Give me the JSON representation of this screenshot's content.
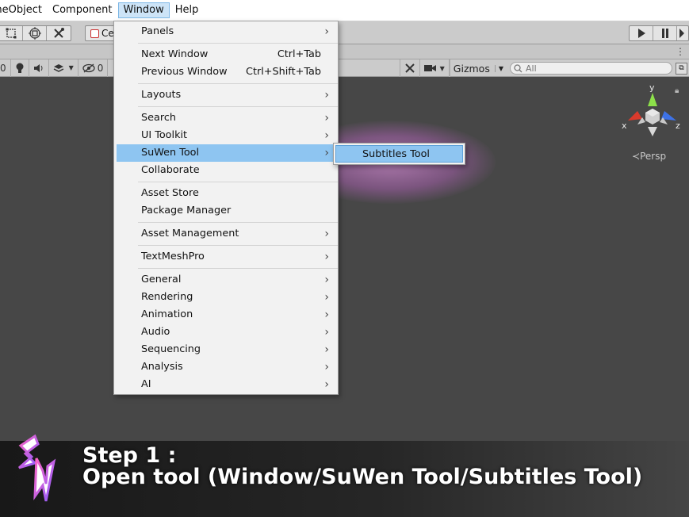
{
  "menubar": {
    "items": [
      "meObject",
      "Component",
      "Window",
      "Help"
    ]
  },
  "toolbar": {
    "pivot_label": "Ce"
  },
  "scene_bar": {
    "left_counter": "0",
    "hidden_count": "0",
    "gizmos_label": "Gizmos",
    "search_placeholder": "All"
  },
  "scene": {
    "persp_label": "Persp",
    "axis_labels": {
      "y": "y",
      "x": "x",
      "z": "z"
    }
  },
  "window_menu": {
    "groups": [
      [
        {
          "label": "Panels",
          "submenu": true
        }
      ],
      [
        {
          "label": "Next Window",
          "shortcut": "Ctrl+Tab"
        },
        {
          "label": "Previous Window",
          "shortcut": "Ctrl+Shift+Tab"
        }
      ],
      [
        {
          "label": "Layouts",
          "submenu": true
        }
      ],
      [
        {
          "label": "Search",
          "submenu": true
        },
        {
          "label": "UI Toolkit",
          "submenu": true
        },
        {
          "label": "SuWen Tool",
          "submenu": true,
          "highlighted": true
        },
        {
          "label": "Collaborate"
        }
      ],
      [
        {
          "label": "Asset Store"
        },
        {
          "label": "Package Manager"
        }
      ],
      [
        {
          "label": "Asset Management",
          "submenu": true
        }
      ],
      [
        {
          "label": "TextMeshPro",
          "submenu": true
        }
      ],
      [
        {
          "label": "General",
          "submenu": true
        },
        {
          "label": "Rendering",
          "submenu": true
        },
        {
          "label": "Animation",
          "submenu": true
        },
        {
          "label": "Audio",
          "submenu": true
        },
        {
          "label": "Sequencing",
          "submenu": true
        },
        {
          "label": "Analysis",
          "submenu": true
        },
        {
          "label": "AI",
          "submenu": true
        }
      ]
    ]
  },
  "submenu": {
    "item": "Subtitles Tool"
  },
  "caption": {
    "line1": "Step 1 :",
    "line2": "Open tool (Window/SuWen Tool/Subtitles Tool)"
  },
  "colors": {
    "menu_highlight": "#8ec5f1",
    "scene_bg": "#474747",
    "glow": "#e08ae8",
    "logo_pink": "#ff4fb0"
  }
}
